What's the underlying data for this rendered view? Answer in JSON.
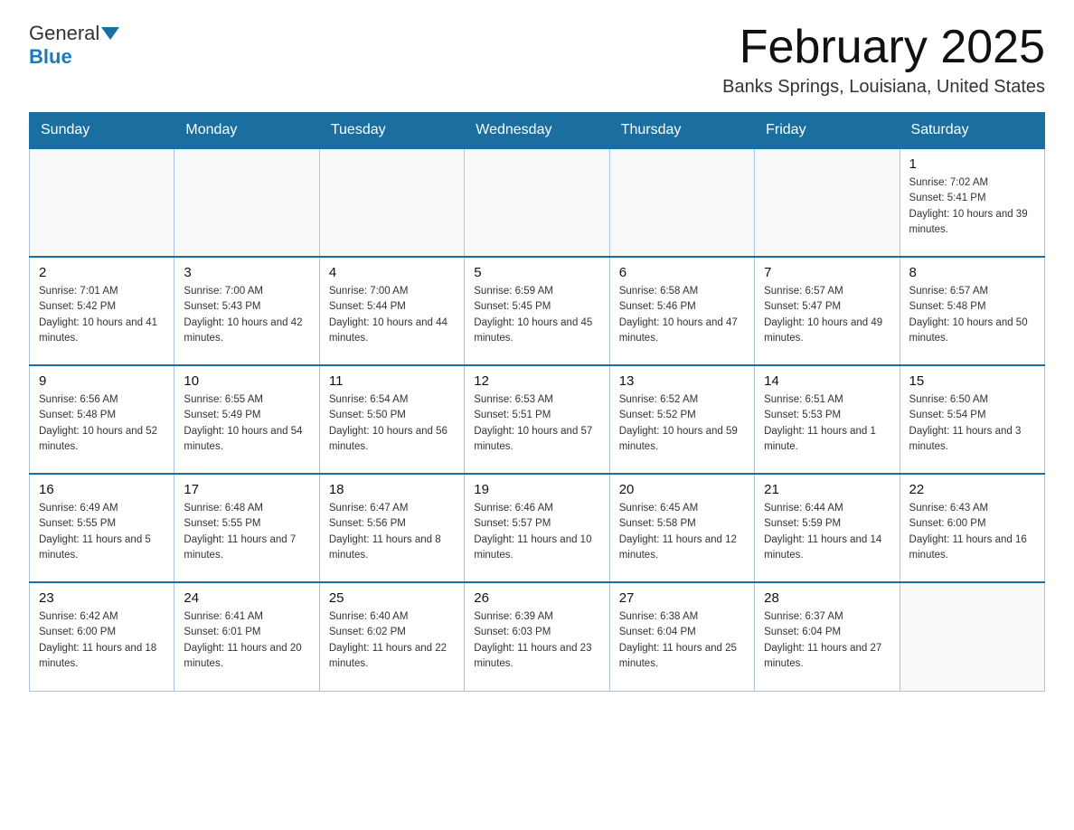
{
  "header": {
    "logo_general": "General",
    "logo_blue": "Blue",
    "title": "February 2025",
    "location": "Banks Springs, Louisiana, United States"
  },
  "weekdays": [
    "Sunday",
    "Monday",
    "Tuesday",
    "Wednesday",
    "Thursday",
    "Friday",
    "Saturday"
  ],
  "weeks": [
    [
      {
        "day": "",
        "sunrise": "",
        "sunset": "",
        "daylight": ""
      },
      {
        "day": "",
        "sunrise": "",
        "sunset": "",
        "daylight": ""
      },
      {
        "day": "",
        "sunrise": "",
        "sunset": "",
        "daylight": ""
      },
      {
        "day": "",
        "sunrise": "",
        "sunset": "",
        "daylight": ""
      },
      {
        "day": "",
        "sunrise": "",
        "sunset": "",
        "daylight": ""
      },
      {
        "day": "",
        "sunrise": "",
        "sunset": "",
        "daylight": ""
      },
      {
        "day": "1",
        "sunrise": "Sunrise: 7:02 AM",
        "sunset": "Sunset: 5:41 PM",
        "daylight": "Daylight: 10 hours and 39 minutes."
      }
    ],
    [
      {
        "day": "2",
        "sunrise": "Sunrise: 7:01 AM",
        "sunset": "Sunset: 5:42 PM",
        "daylight": "Daylight: 10 hours and 41 minutes."
      },
      {
        "day": "3",
        "sunrise": "Sunrise: 7:00 AM",
        "sunset": "Sunset: 5:43 PM",
        "daylight": "Daylight: 10 hours and 42 minutes."
      },
      {
        "day": "4",
        "sunrise": "Sunrise: 7:00 AM",
        "sunset": "Sunset: 5:44 PM",
        "daylight": "Daylight: 10 hours and 44 minutes."
      },
      {
        "day": "5",
        "sunrise": "Sunrise: 6:59 AM",
        "sunset": "Sunset: 5:45 PM",
        "daylight": "Daylight: 10 hours and 45 minutes."
      },
      {
        "day": "6",
        "sunrise": "Sunrise: 6:58 AM",
        "sunset": "Sunset: 5:46 PM",
        "daylight": "Daylight: 10 hours and 47 minutes."
      },
      {
        "day": "7",
        "sunrise": "Sunrise: 6:57 AM",
        "sunset": "Sunset: 5:47 PM",
        "daylight": "Daylight: 10 hours and 49 minutes."
      },
      {
        "day": "8",
        "sunrise": "Sunrise: 6:57 AM",
        "sunset": "Sunset: 5:48 PM",
        "daylight": "Daylight: 10 hours and 50 minutes."
      }
    ],
    [
      {
        "day": "9",
        "sunrise": "Sunrise: 6:56 AM",
        "sunset": "Sunset: 5:48 PM",
        "daylight": "Daylight: 10 hours and 52 minutes."
      },
      {
        "day": "10",
        "sunrise": "Sunrise: 6:55 AM",
        "sunset": "Sunset: 5:49 PM",
        "daylight": "Daylight: 10 hours and 54 minutes."
      },
      {
        "day": "11",
        "sunrise": "Sunrise: 6:54 AM",
        "sunset": "Sunset: 5:50 PM",
        "daylight": "Daylight: 10 hours and 56 minutes."
      },
      {
        "day": "12",
        "sunrise": "Sunrise: 6:53 AM",
        "sunset": "Sunset: 5:51 PM",
        "daylight": "Daylight: 10 hours and 57 minutes."
      },
      {
        "day": "13",
        "sunrise": "Sunrise: 6:52 AM",
        "sunset": "Sunset: 5:52 PM",
        "daylight": "Daylight: 10 hours and 59 minutes."
      },
      {
        "day": "14",
        "sunrise": "Sunrise: 6:51 AM",
        "sunset": "Sunset: 5:53 PM",
        "daylight": "Daylight: 11 hours and 1 minute."
      },
      {
        "day": "15",
        "sunrise": "Sunrise: 6:50 AM",
        "sunset": "Sunset: 5:54 PM",
        "daylight": "Daylight: 11 hours and 3 minutes."
      }
    ],
    [
      {
        "day": "16",
        "sunrise": "Sunrise: 6:49 AM",
        "sunset": "Sunset: 5:55 PM",
        "daylight": "Daylight: 11 hours and 5 minutes."
      },
      {
        "day": "17",
        "sunrise": "Sunrise: 6:48 AM",
        "sunset": "Sunset: 5:55 PM",
        "daylight": "Daylight: 11 hours and 7 minutes."
      },
      {
        "day": "18",
        "sunrise": "Sunrise: 6:47 AM",
        "sunset": "Sunset: 5:56 PM",
        "daylight": "Daylight: 11 hours and 8 minutes."
      },
      {
        "day": "19",
        "sunrise": "Sunrise: 6:46 AM",
        "sunset": "Sunset: 5:57 PM",
        "daylight": "Daylight: 11 hours and 10 minutes."
      },
      {
        "day": "20",
        "sunrise": "Sunrise: 6:45 AM",
        "sunset": "Sunset: 5:58 PM",
        "daylight": "Daylight: 11 hours and 12 minutes."
      },
      {
        "day": "21",
        "sunrise": "Sunrise: 6:44 AM",
        "sunset": "Sunset: 5:59 PM",
        "daylight": "Daylight: 11 hours and 14 minutes."
      },
      {
        "day": "22",
        "sunrise": "Sunrise: 6:43 AM",
        "sunset": "Sunset: 6:00 PM",
        "daylight": "Daylight: 11 hours and 16 minutes."
      }
    ],
    [
      {
        "day": "23",
        "sunrise": "Sunrise: 6:42 AM",
        "sunset": "Sunset: 6:00 PM",
        "daylight": "Daylight: 11 hours and 18 minutes."
      },
      {
        "day": "24",
        "sunrise": "Sunrise: 6:41 AM",
        "sunset": "Sunset: 6:01 PM",
        "daylight": "Daylight: 11 hours and 20 minutes."
      },
      {
        "day": "25",
        "sunrise": "Sunrise: 6:40 AM",
        "sunset": "Sunset: 6:02 PM",
        "daylight": "Daylight: 11 hours and 22 minutes."
      },
      {
        "day": "26",
        "sunrise": "Sunrise: 6:39 AM",
        "sunset": "Sunset: 6:03 PM",
        "daylight": "Daylight: 11 hours and 23 minutes."
      },
      {
        "day": "27",
        "sunrise": "Sunrise: 6:38 AM",
        "sunset": "Sunset: 6:04 PM",
        "daylight": "Daylight: 11 hours and 25 minutes."
      },
      {
        "day": "28",
        "sunrise": "Sunrise: 6:37 AM",
        "sunset": "Sunset: 6:04 PM",
        "daylight": "Daylight: 11 hours and 27 minutes."
      },
      {
        "day": "",
        "sunrise": "",
        "sunset": "",
        "daylight": ""
      }
    ]
  ]
}
